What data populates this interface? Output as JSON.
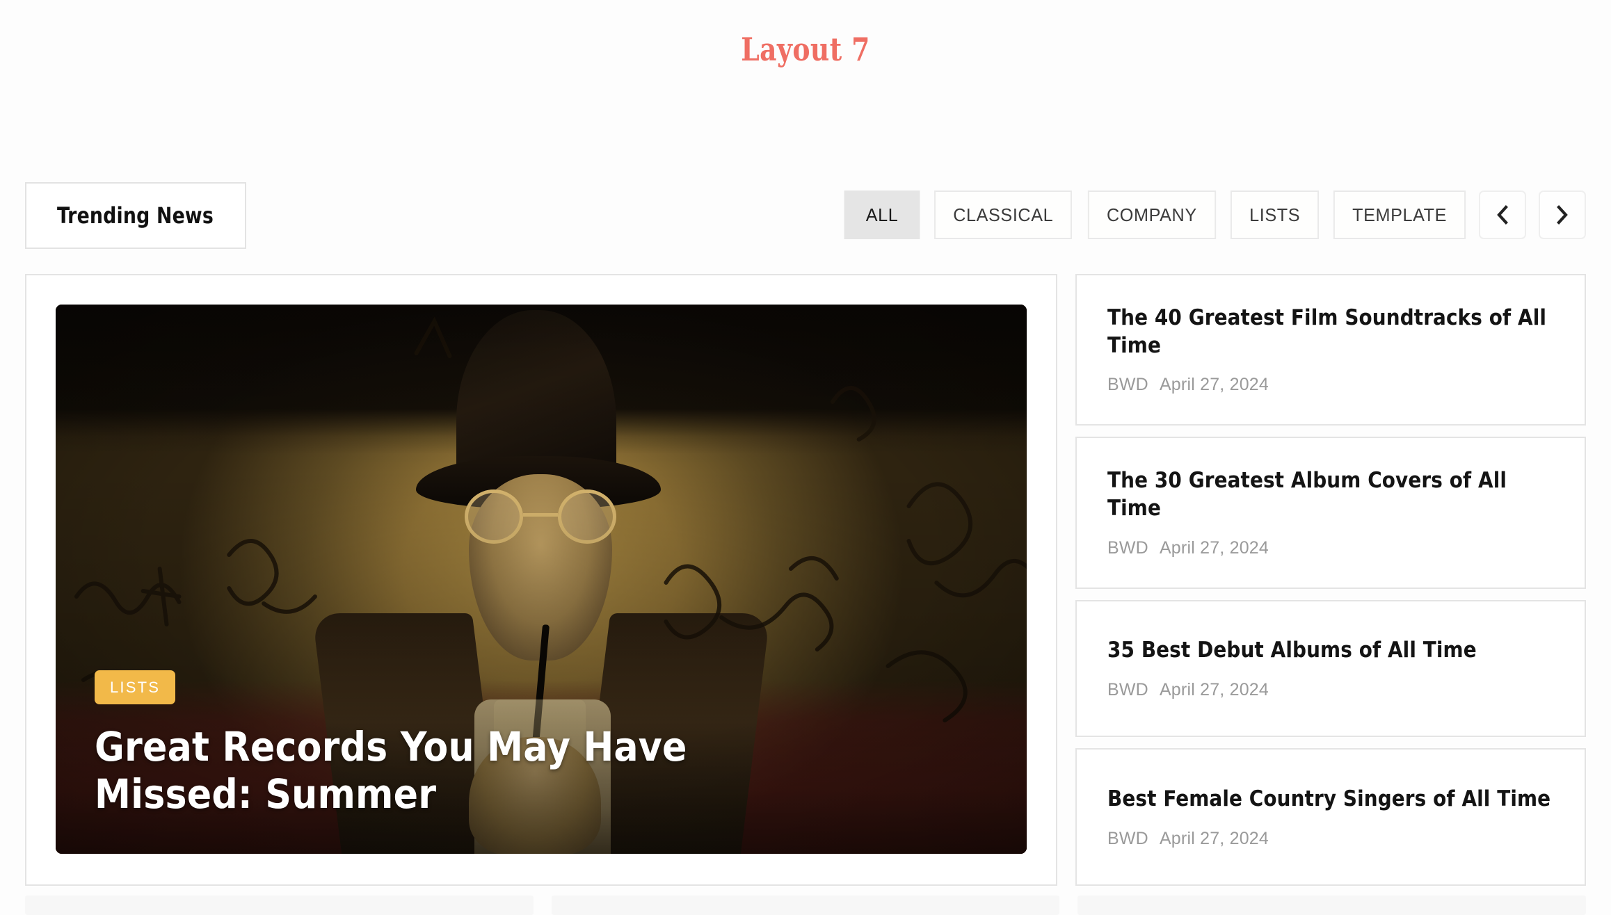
{
  "page": {
    "title": "Layout 7",
    "title_color": "#ef6e63",
    "background": "#fdfdfd"
  },
  "widget": {
    "section_title": "Trending News",
    "filters": [
      {
        "label": "ALL",
        "active": true
      },
      {
        "label": "CLASSICAL",
        "active": false
      },
      {
        "label": "COMPANY",
        "active": false
      },
      {
        "label": "LISTS",
        "active": false
      },
      {
        "label": "TEMPLATE",
        "active": false
      }
    ],
    "nav": {
      "prev_icon": "chevron-left-icon",
      "next_icon": "chevron-right-icon"
    }
  },
  "featured": {
    "category": "LISTS",
    "category_color": "#f2b949",
    "title": "Great Records You May Have Missed: Summer",
    "image_alt": "Man in a fedora and round glasses sipping a drink in a graffiti-covered bar booth"
  },
  "sidebar": {
    "items": [
      {
        "title": "The 40 Greatest Film Soundtracks of All Time",
        "author": "BWD",
        "date": "April 27, 2024"
      },
      {
        "title": "The 30 Greatest Album Covers of All Time",
        "author": "BWD",
        "date": "April 27, 2024"
      },
      {
        "title": "35 Best Debut Albums of All Time",
        "author": "BWD",
        "date": "April 27, 2024"
      },
      {
        "title": "Best Female Country Singers of All Time",
        "author": "BWD",
        "date": "April 27, 2024"
      }
    ]
  }
}
